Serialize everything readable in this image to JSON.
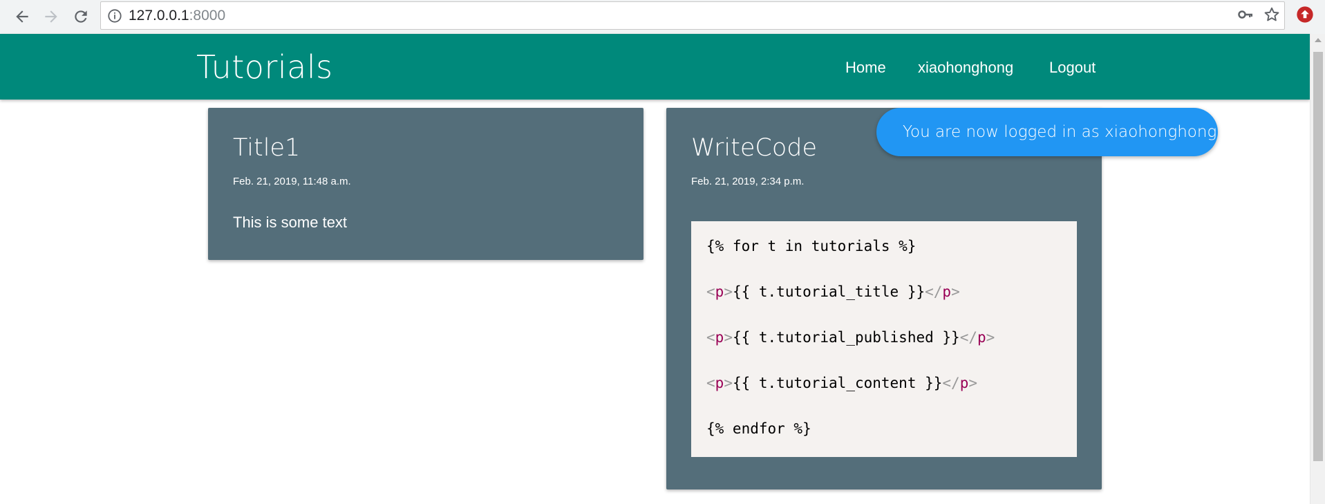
{
  "browser": {
    "url_host": "127.0.0.1",
    "url_port": ":8000",
    "icons": [
      "back-arrow-icon",
      "forward-arrow-icon",
      "reload-icon",
      "info-icon",
      "key-icon",
      "star-icon",
      "extension-icon"
    ]
  },
  "navbar": {
    "brand": "Tutorials",
    "links": [
      "Home",
      "xiaohonghong",
      "Logout"
    ],
    "color": "#00897b"
  },
  "cards": [
    {
      "title": "Title1",
      "date": "Feb. 21, 2019, 11:48 a.m.",
      "text": "This is some text"
    },
    {
      "title": "WriteCode",
      "date": "Feb. 21, 2019, 2:34 p.m.",
      "code_lines": [
        "{% for t in tutorials %}",
        "{{ t.tutorial_title }}",
        "{{ t.tutorial_published }}",
        "{{ t.tutorial_content }}",
        "{% endfor %}"
      ],
      "tag_open": "<",
      "tag_name": "p",
      "tag_close": ">",
      "tag_end_open": "</"
    }
  ],
  "toast": {
    "message": "You are now logged in as xiaohonghong",
    "color": "#2196f3"
  },
  "card_color": "#546e7a"
}
